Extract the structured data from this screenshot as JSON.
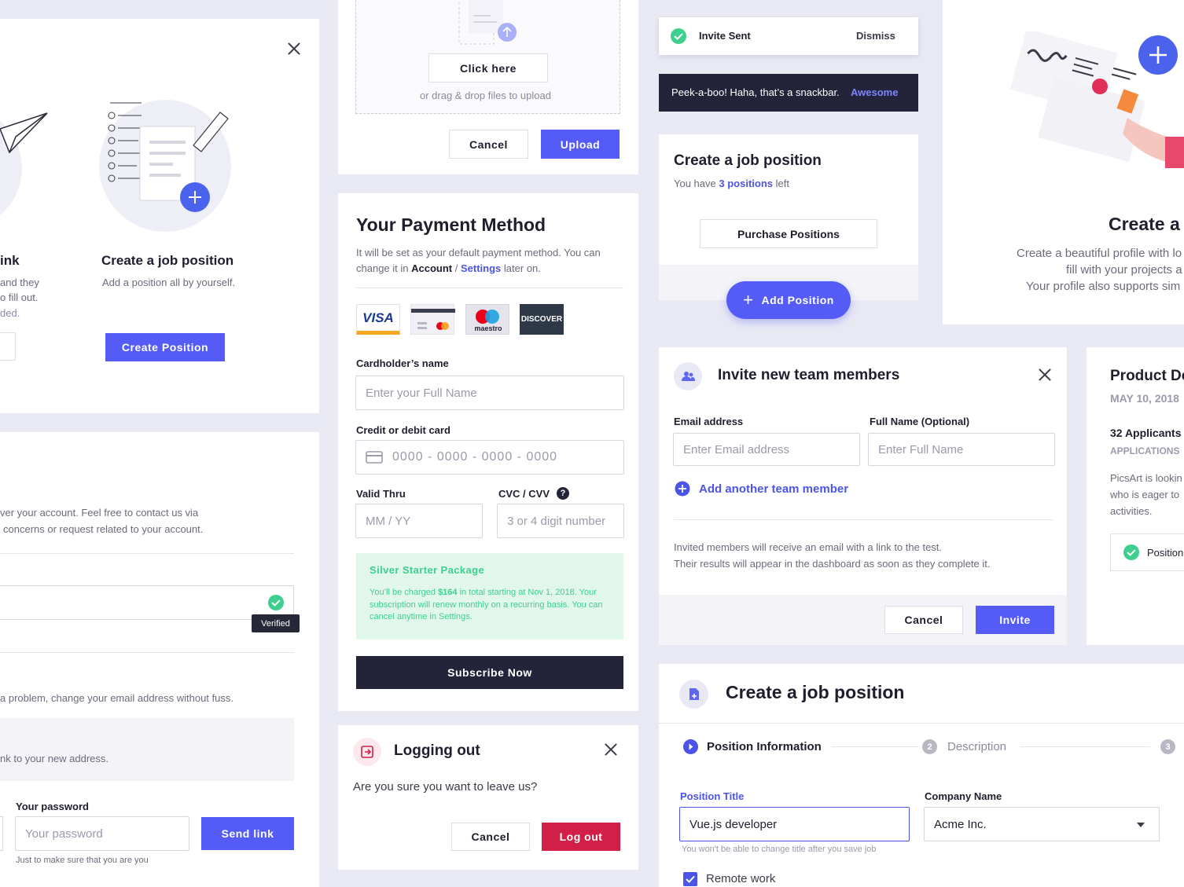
{
  "job_card_left": {
    "partial_title": "ink",
    "partial_lines": [
      "and they",
      "o fill out.",
      "ded."
    ],
    "title": "Create a job position",
    "subtitle": "Add a position all by yourself.",
    "button": "Create Position"
  },
  "account_card": {
    "desc_line1": "ver your account. Feel free to contact us via",
    "desc_line2": "concerns or request related to your account.",
    "verified_tooltip": "Verified",
    "email_help": "a problem, change your email address without fuss.",
    "info_text": "nk to your new address.",
    "password_label": "Your password",
    "password_placeholder": "Your password",
    "password_help": "Just to make sure that you are you",
    "send_button": "Send link"
  },
  "upload_card": {
    "click_here": "Click here",
    "drag_text": "or drag & drop files to upload",
    "cancel": "Cancel",
    "upload": "Upload"
  },
  "payment_card": {
    "title": "Your Payment Method",
    "desc_pre": "It will be set as your default payment method. You can change it in",
    "desc_account": "Account",
    "desc_sep": "/",
    "desc_settings": "Settings",
    "desc_post": "later on.",
    "cards": [
      "VISA",
      "maestro",
      "DISCOVER"
    ],
    "cardholder_label": "Cardholder’s name",
    "cardholder_placeholder": "Enter your Full Name",
    "card_label": "Credit or debit card",
    "card_placeholder": "0000 - 0000 - 0000 - 0000",
    "valid_label": "Valid Thru",
    "valid_placeholder": "MM / YY",
    "cvc_label": "CVC / CVV",
    "cvc_placeholder": "3 or 4 digit number",
    "package_title": "Silver Starter Package",
    "package_pre": "You’ll be charged",
    "package_amount": "$164",
    "package_post": "in total starting at Nov 1, 2018. Your subscription will renew monthly on a recurring basis. You can cancel anytime in Settings.",
    "subscribe": "Subscribe Now"
  },
  "logout_card": {
    "title": "Logging out",
    "question": "Are you sure you want to leave us?",
    "cancel": "Cancel",
    "confirm": "Log out"
  },
  "toast": {
    "text": "Invite Sent",
    "dismiss": "Dismiss"
  },
  "snackbar": {
    "text": "Peek-a-boo! Haha, that’s a snackbar.",
    "action": "Awesome"
  },
  "positions_card": {
    "title": "Create a job position",
    "pre": "You have",
    "count": "3 positions",
    "post": "left",
    "purchase": "Purchase Positions",
    "add": "Add Position"
  },
  "profile_card": {
    "title": "Create a",
    "line1": "Create a beautiful profile with lo",
    "line2": "fill with your projects a",
    "line3": "Your profile also supports sim"
  },
  "invite_card": {
    "title": "Invite new team members",
    "email_label": "Email address",
    "email_placeholder": "Enter Email address",
    "name_label": "Full Name (Optional)",
    "name_placeholder": "Enter Full Name",
    "add_member": "Add another team member",
    "info_line1": "Invited members will receive an email with a link to the test.",
    "info_line2": "Their results will appear in the dashboard as soon as they complete it.",
    "cancel": "Cancel",
    "invite": "Invite"
  },
  "product_card": {
    "title": "Product De",
    "date": "MAY 10, 2018",
    "applicants": "32 Applicants",
    "applications": "APPLICATIONS",
    "desc1": "PicsArt is lookin",
    "desc2": "who is eager to",
    "desc3": "activities.",
    "badge": "Position"
  },
  "job_form": {
    "title": "Create a job position",
    "steps": [
      {
        "num": "",
        "label": "Position Information"
      },
      {
        "num": "2",
        "label": "Description"
      },
      {
        "num": "3",
        "label": ""
      }
    ],
    "position_title_label": "Position Title",
    "position_title_value": "Vue.js developer",
    "position_title_help": "You won't be able to change title after you save job",
    "company_label": "Company Name",
    "company_value": "Acme Inc.",
    "remote_label": "Remote work"
  },
  "colors": {
    "primary": "#545cf5",
    "dark": "#23243a",
    "danger": "#d21f47",
    "success": "#3ecf8e",
    "background": "#e9e9f4"
  }
}
